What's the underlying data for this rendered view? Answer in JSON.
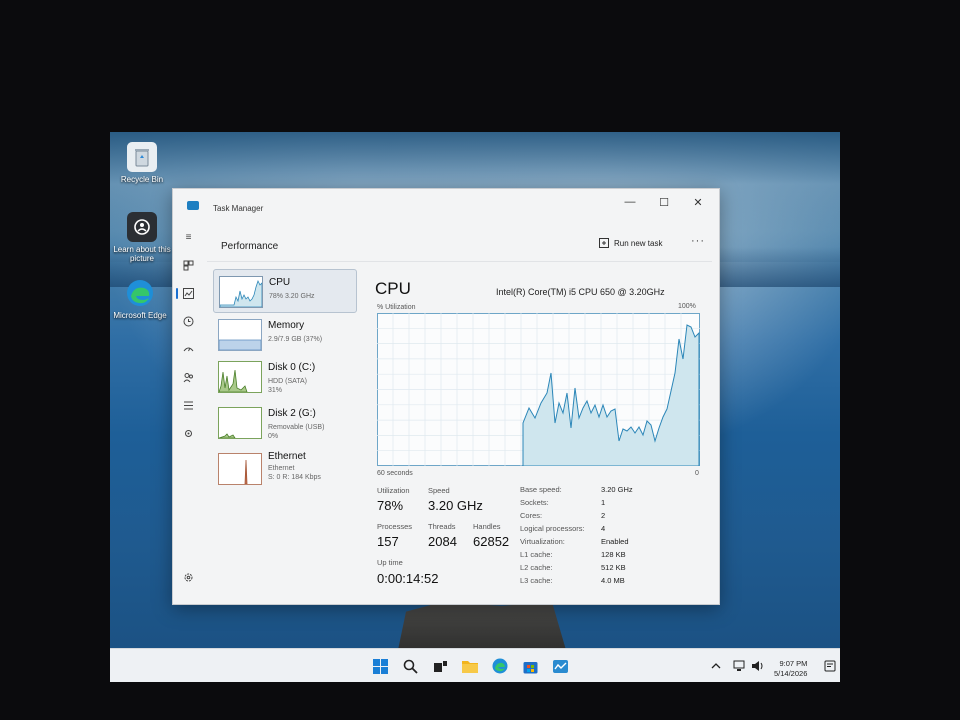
{
  "desktop": {
    "icons": [
      {
        "label": "Recycle Bin",
        "icon": "recycle-bin-icon"
      },
      {
        "label": "Learn about this picture",
        "icon": "learn-about-picture-icon"
      },
      {
        "label": "Microsoft Edge",
        "icon": "edge-icon"
      }
    ]
  },
  "window": {
    "title": "Task Manager",
    "controls": {
      "minimize": "—",
      "maximize": "☐",
      "close": "✕"
    }
  },
  "header": {
    "section": "Performance",
    "run_new_task": "Run new task",
    "more": "···"
  },
  "devices": [
    {
      "name": "CPU",
      "sub1": "78% 3.20 GHz",
      "sub2": "",
      "sub3": ""
    },
    {
      "name": "Memory",
      "sub1": "2.9/7.9 GB (37%)",
      "sub2": "",
      "sub3": ""
    },
    {
      "name": "Disk 0 (C:)",
      "sub1": "HDD (SATA)",
      "sub2": "31%",
      "sub3": ""
    },
    {
      "name": "Disk 2 (G:)",
      "sub1": "Removable (USB)",
      "sub2": "0%",
      "sub3": ""
    },
    {
      "name": "Ethernet",
      "sub1": "Ethernet",
      "sub2": "S: 0 R: 184 Kbps",
      "sub3": ""
    }
  ],
  "cpu": {
    "title": "CPU",
    "model": "Intel(R) Core(TM) i5 CPU 650 @ 3.20GHz",
    "util_label": "% Utilization",
    "util_max": "100%",
    "graph_left": "60 seconds",
    "graph_right": "0",
    "utilization_label": "Utilization",
    "utilization": "78%",
    "speed_label": "Speed",
    "speed": "3.20 GHz",
    "processes_label": "Processes",
    "processes": "157",
    "threads_label": "Threads",
    "threads": "2084",
    "handles_label": "Handles",
    "handles": "62852",
    "uptime_label": "Up time",
    "uptime": "0:00:14:52",
    "details": [
      {
        "k": "Base speed:",
        "v": "3.20 GHz"
      },
      {
        "k": "Sockets:",
        "v": "1"
      },
      {
        "k": "Cores:",
        "v": "2"
      },
      {
        "k": "Logical processors:",
        "v": "4"
      },
      {
        "k": "Virtualization:",
        "v": "Enabled"
      },
      {
        "k": "L1 cache:",
        "v": "128 KB"
      },
      {
        "k": "L2 cache:",
        "v": "512 KB"
      },
      {
        "k": "L3 cache:",
        "v": "4.0 MB"
      }
    ]
  },
  "taskbar": {
    "time": "9:07 PM",
    "date": "5/14/2026"
  },
  "colors": {
    "graph_line": "#2b86b8",
    "graph_fill": "#cfe6ee",
    "accent": "#1a6fd0"
  }
}
